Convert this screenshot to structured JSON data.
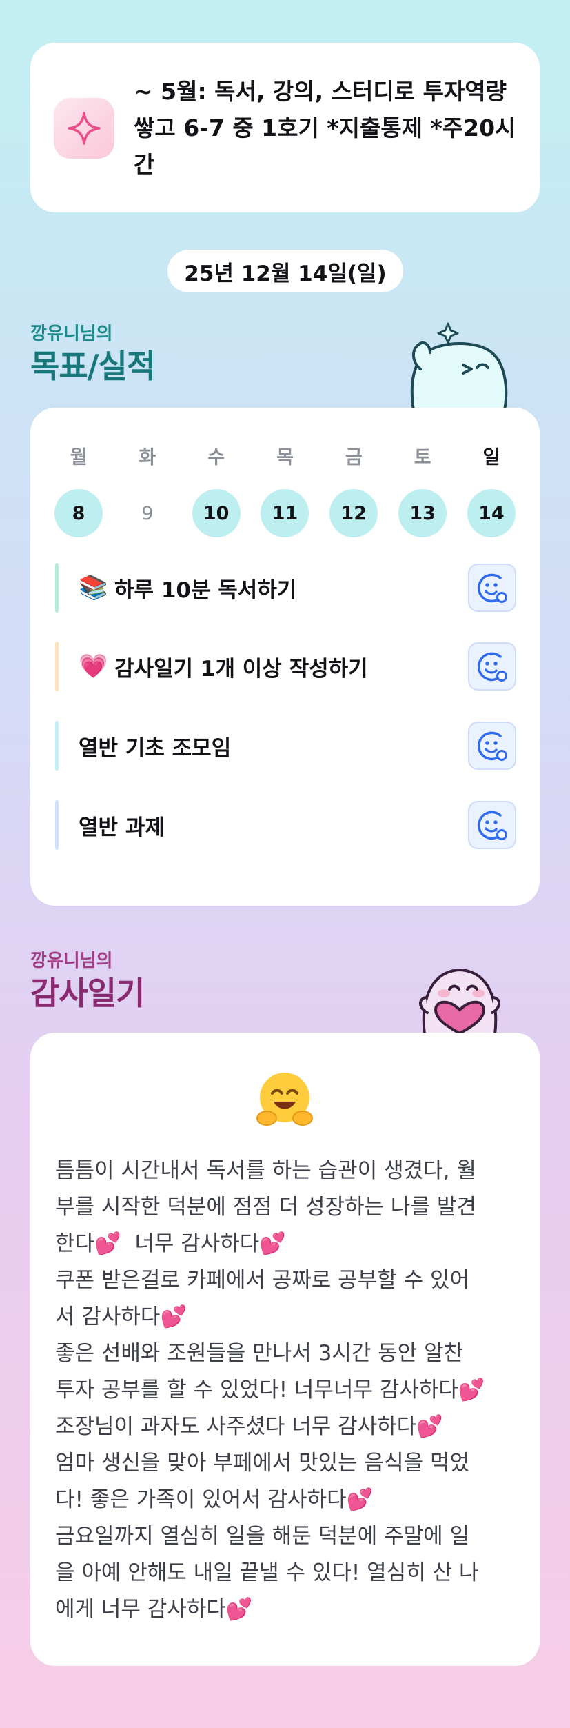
{
  "goal_banner": {
    "icon": "sparkle-icon",
    "text": "~ 5월: 독서, 강의, 스터디로 투자역량 쌓고 6-7 중 1호기 *지출통제 *주20시간"
  },
  "date_label": "25년 12월 14일(일)",
  "goals_section": {
    "subtitle": "깡유니님의",
    "title": "목표/실적"
  },
  "week": {
    "days": [
      {
        "name": "월",
        "date": "8",
        "done": true,
        "today": false
      },
      {
        "name": "화",
        "date": "9",
        "done": false,
        "today": false
      },
      {
        "name": "수",
        "date": "10",
        "done": true,
        "today": false
      },
      {
        "name": "목",
        "date": "11",
        "done": true,
        "today": false
      },
      {
        "name": "금",
        "date": "12",
        "done": true,
        "today": false
      },
      {
        "name": "토",
        "date": "13",
        "done": true,
        "today": false
      },
      {
        "name": "일",
        "date": "14",
        "done": true,
        "today": true
      }
    ]
  },
  "tasks": [
    {
      "emoji": "📚",
      "label": "하루 10분 독서하기",
      "bar_color": "#b7ebd9"
    },
    {
      "emoji": "💗",
      "label": "감사일기 1개 이상 작성하기",
      "bar_color": "#fde2c0"
    },
    {
      "emoji": "",
      "label": "열반 기초 조모임",
      "bar_color": "#c4eef1"
    },
    {
      "emoji": "",
      "label": "열반 과제",
      "bar_color": "#d2e0fb"
    }
  ],
  "task_button_icon": "smiley-add-icon",
  "gratitude_section": {
    "subtitle": "깡유니님의",
    "title": "감사일기"
  },
  "gratitude": {
    "mood_icon": "hugging-face-icon",
    "lines": [
      "틈틈이 시간내서 독서를 하는 습관이 생겼다, 월",
      "부를 시작한 덕분에 점점 더 성장하는 나를 발견",
      "한다💕  너무 감사하다💕",
      "쿠폰 받은걸로 카페에서 공짜로 공부할 수 있어",
      "서 감사하다💕",
      "좋은 선배와 조원들을 만나서 3시간 동안 알찬",
      "투자 공부를 할 수 있었다! 너무너무 감사하다💕",
      "조장님이 과자도 사주셨다 너무 감사하다💕",
      "엄마 생신을 맞아 부페에서 맛있는 음식을 먹었",
      "다! 좋은 가족이 있어서 감사하다💕",
      "금요일까지 열심히 일을 해둔 덕분에 주말에 일",
      "을 아예 안해도 내일 끝낼 수 있다! 열심히 산 나",
      "에게 너무 감사하다💕"
    ]
  },
  "colors": {
    "teal_title": "#17777a",
    "magenta_title": "#8a2b72",
    "done_circle": "#bdeff1",
    "button_blue": "#2f6bef"
  }
}
